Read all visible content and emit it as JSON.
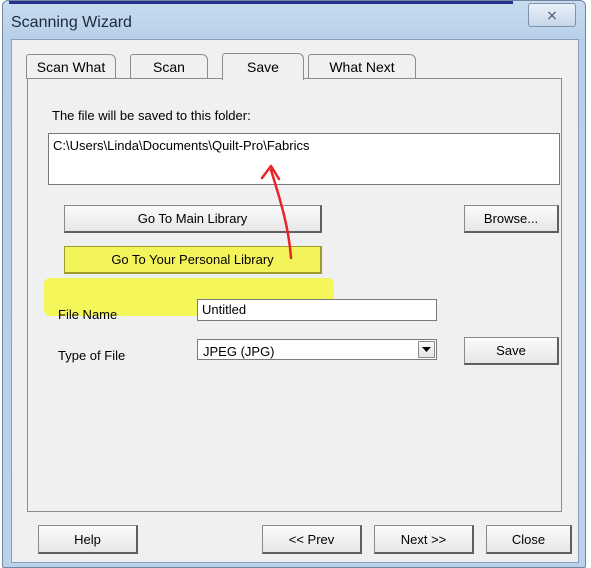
{
  "window": {
    "title": "Scanning Wizard",
    "close_glyph": "⨯"
  },
  "tabs": [
    {
      "label": "Scan What",
      "active": false
    },
    {
      "label": "Scan",
      "active": false
    },
    {
      "label": "Save",
      "active": true
    },
    {
      "label": "What Next",
      "active": false
    }
  ],
  "save_panel": {
    "folder_label": "The file will be saved to this folder:",
    "folder_path": "C:\\Users\\Linda\\Documents\\Quilt-Pro\\Fabrics",
    "main_library_label": "Go To Main Library",
    "personal_library_label": "Go To Your Personal Library",
    "browse_label": "Browse...",
    "file_name_label": "File Name",
    "file_name_value": "Untitled",
    "file_type_label": "Type of File",
    "file_type_value": "JPEG (JPG)",
    "save_label": "Save"
  },
  "footer": {
    "help_label": "Help",
    "prev_label": "<< Prev",
    "next_label": "Next >>",
    "close_label": "Close"
  },
  "colors": {
    "highlight": "#f3f45a",
    "annotation_arrow": "#e8242a"
  }
}
